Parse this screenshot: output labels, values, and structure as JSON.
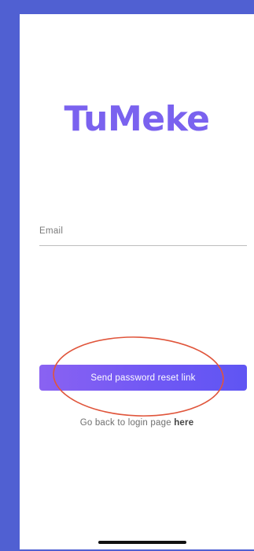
{
  "app": {
    "logo_text": "TuMeke"
  },
  "form": {
    "email_label": "Email",
    "submit_label": "Send password reset link",
    "back_text": "Go back to login page",
    "back_link": "here"
  },
  "colors": {
    "page_background": "#5060d2",
    "brand": "#7a62ef",
    "button_gradient_start": "#8a62f2",
    "button_gradient_end": "#5f55f3",
    "annotation_ring": "#e0553b"
  }
}
